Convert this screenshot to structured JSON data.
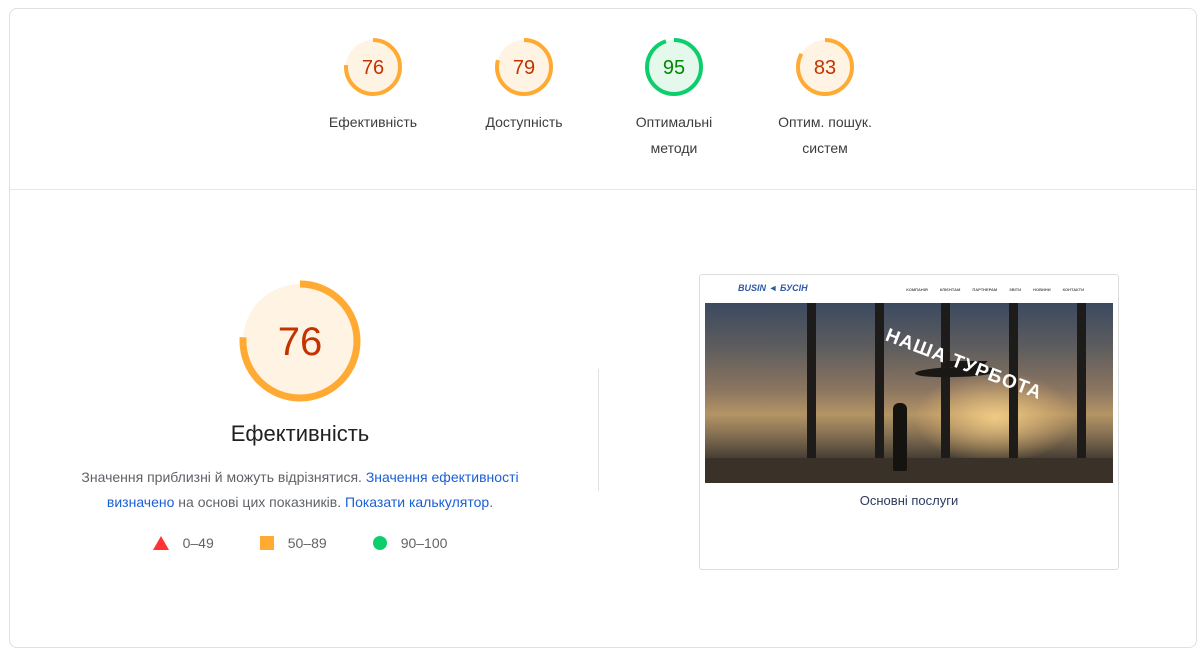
{
  "gauges": [
    {
      "score": "76",
      "label_lines": [
        "Ефективність",
        ""
      ],
      "color": "#ffaa33",
      "text_color": "#c33300",
      "fill": "#fff3e3",
      "fraction": 0.76
    },
    {
      "score": "79",
      "label_lines": [
        "Доступність",
        ""
      ],
      "color": "#ffaa33",
      "text_color": "#c33300",
      "fill": "#fff3e3",
      "fraction": 0.79
    },
    {
      "score": "95",
      "label_lines": [
        "Оптимальні",
        "методи"
      ],
      "color": "#0cce6b",
      "text_color": "#008800",
      "fill": "#e5f8ec",
      "fraction": 0.95
    },
    {
      "score": "83",
      "label_lines": [
        "Оптим. пошук.",
        "систем"
      ],
      "color": "#ffaa33",
      "text_color": "#c33300",
      "fill": "#fff3e3",
      "fraction": 0.83
    }
  ],
  "main": {
    "score": "76",
    "fraction": 0.76,
    "title": "Ефективність",
    "desc_part1": "Значення приблизні й можуть відрізнятися. ",
    "desc_link1": "Значення ефективності визначено",
    "desc_part2": " на основі цих показників. ",
    "desc_link2": "Показати калькулятор",
    "desc_part3": "."
  },
  "legend": [
    {
      "shape": "triangle",
      "label": "0–49",
      "color": "#ff3333"
    },
    {
      "shape": "square",
      "label": "50–89",
      "color": "#ffaa33"
    },
    {
      "shape": "circle",
      "label": "90–100",
      "color": "#0cce6b"
    }
  ],
  "screenshot": {
    "logo_left": "BUSIN",
    "logo_right": "БУСІН",
    "nav": [
      "КОМПАНІЯ",
      "КЛІЄНТАМ",
      "ПАРТНЕРАМ",
      "ЗВІТИ",
      "НОВИНИ",
      "КОНТАКТИ"
    ],
    "banner": "НАША ТУРБОТА",
    "services": "Основні послуги"
  }
}
